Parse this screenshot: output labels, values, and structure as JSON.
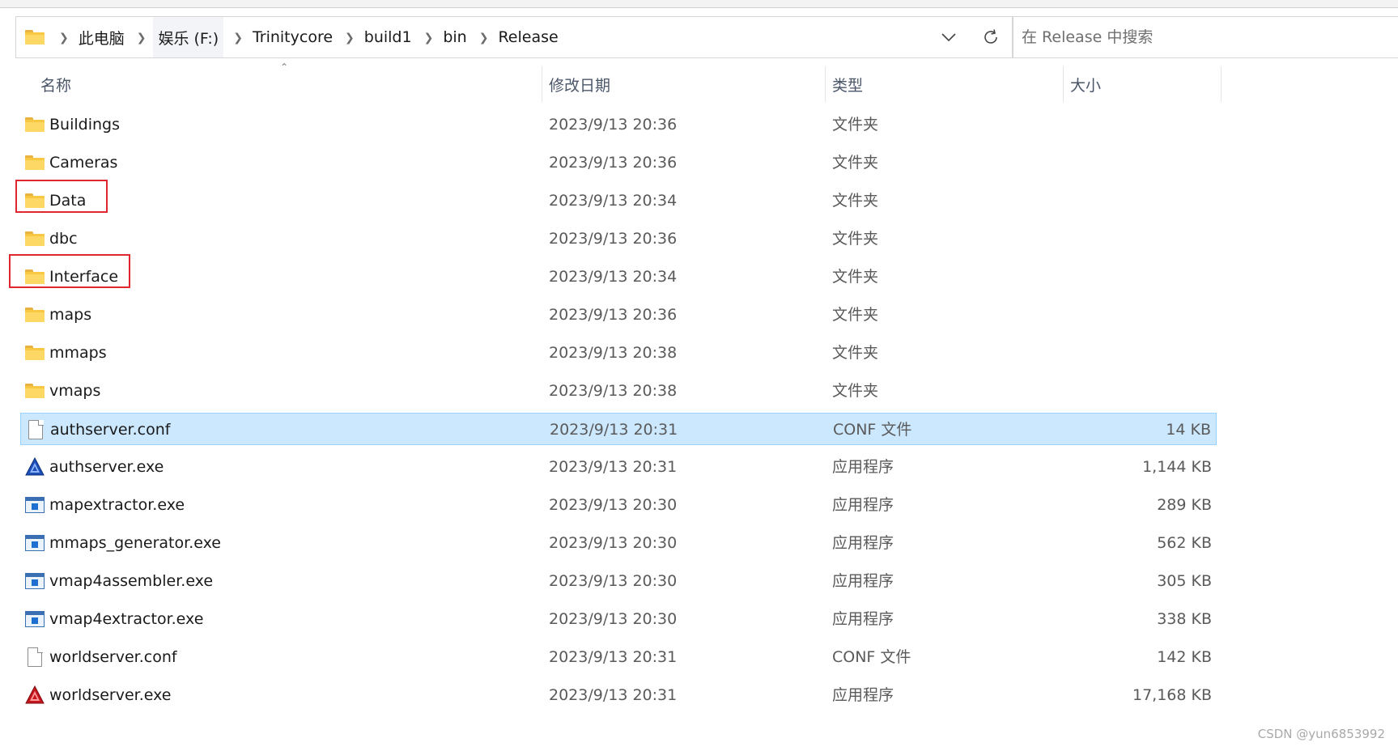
{
  "address": {
    "crumbs": [
      "此电脑",
      "娱乐 (F:)",
      "Trinitycore",
      "build1",
      "bin",
      "Release"
    ]
  },
  "search": {
    "placeholder": "在 Release 中搜索"
  },
  "columns": {
    "name": "名称",
    "date": "修改日期",
    "type": "类型",
    "size": "大小"
  },
  "files": [
    {
      "name": "Buildings",
      "date": "2023/9/13 20:36",
      "type": "文件夹",
      "size": "",
      "icon": "folder-icon"
    },
    {
      "name": "Cameras",
      "date": "2023/9/13 20:36",
      "type": "文件夹",
      "size": "",
      "icon": "folder-icon"
    },
    {
      "name": "Data",
      "date": "2023/9/13 20:34",
      "type": "文件夹",
      "size": "",
      "icon": "folder-icon"
    },
    {
      "name": "dbc",
      "date": "2023/9/13 20:36",
      "type": "文件夹",
      "size": "",
      "icon": "folder-icon"
    },
    {
      "name": "Interface",
      "date": "2023/9/13 20:34",
      "type": "文件夹",
      "size": "",
      "icon": "folder-icon"
    },
    {
      "name": "maps",
      "date": "2023/9/13 20:36",
      "type": "文件夹",
      "size": "",
      "icon": "folder-icon"
    },
    {
      "name": "mmaps",
      "date": "2023/9/13 20:38",
      "type": "文件夹",
      "size": "",
      "icon": "folder-icon"
    },
    {
      "name": "vmaps",
      "date": "2023/9/13 20:38",
      "type": "文件夹",
      "size": "",
      "icon": "folder-icon"
    },
    {
      "name": "authserver.conf",
      "date": "2023/9/13 20:31",
      "type": "CONF 文件",
      "size": "14 KB",
      "icon": "document-icon"
    },
    {
      "name": "authserver.exe",
      "date": "2023/9/13 20:31",
      "type": "应用程序",
      "size": "1,144 KB",
      "icon": "authserver-app-icon"
    },
    {
      "name": "mapextractor.exe",
      "date": "2023/9/13 20:30",
      "type": "应用程序",
      "size": "289 KB",
      "icon": "app-window-icon"
    },
    {
      "name": "mmaps_generator.exe",
      "date": "2023/9/13 20:30",
      "type": "应用程序",
      "size": "562 KB",
      "icon": "app-window-icon"
    },
    {
      "name": "vmap4assembler.exe",
      "date": "2023/9/13 20:30",
      "type": "应用程序",
      "size": "305 KB",
      "icon": "app-window-icon"
    },
    {
      "name": "vmap4extractor.exe",
      "date": "2023/9/13 20:30",
      "type": "应用程序",
      "size": "338 KB",
      "icon": "app-window-icon"
    },
    {
      "name": "worldserver.conf",
      "date": "2023/9/13 20:31",
      "type": "CONF 文件",
      "size": "142 KB",
      "icon": "document-icon"
    },
    {
      "name": "worldserver.exe",
      "date": "2023/9/13 20:31",
      "type": "应用程序",
      "size": "17,168 KB",
      "icon": "worldserver-app-icon"
    }
  ],
  "selected_file": "authserver.conf",
  "highlighted_files": [
    "Data",
    "Interface"
  ],
  "colors": {
    "selection": "#cce8ff",
    "selection_border": "#99d1ff",
    "highlight_box": "#e0262e",
    "folder": "#f8c843"
  },
  "watermark": "CSDN @yun6853992"
}
